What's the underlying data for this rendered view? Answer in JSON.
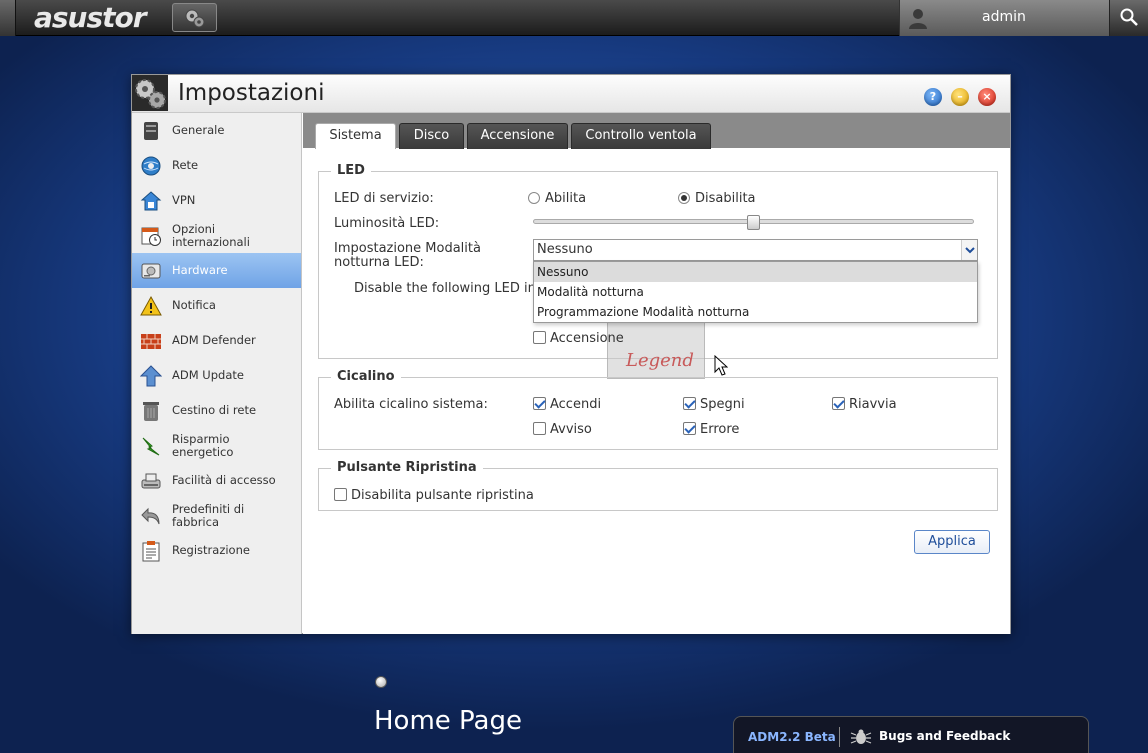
{
  "topbar": {
    "logo": "asustor",
    "user": "admin"
  },
  "window": {
    "title": "Impostazioni",
    "help_label": "?",
    "min_label": "–",
    "close_label": "×"
  },
  "sidebar": {
    "items": [
      {
        "label": "Generale",
        "icon": "server-icon"
      },
      {
        "label": "Rete",
        "icon": "globe-icon"
      },
      {
        "label": "VPN",
        "icon": "vpn-icon"
      },
      {
        "label": "Opzioni internazionali",
        "icon": "calendar-clock-icon"
      },
      {
        "label": "Hardware",
        "icon": "hard-drive-icon"
      },
      {
        "label": "Notifica",
        "icon": "warning-icon"
      },
      {
        "label": "ADM Defender",
        "icon": "firewall-icon"
      },
      {
        "label": "ADM Update",
        "icon": "update-arrow-icon"
      },
      {
        "label": "Cestino di rete",
        "icon": "trash-icon"
      },
      {
        "label": "Risparmio energetico",
        "icon": "lightning-icon"
      },
      {
        "label": "Facilità di accesso",
        "icon": "access-icon"
      },
      {
        "label": "Predefiniti di fabbrica",
        "icon": "undo-icon"
      },
      {
        "label": "Registrazione",
        "icon": "clipboard-icon"
      }
    ],
    "active": "Hardware"
  },
  "tabs": [
    "Sistema",
    "Disco",
    "Accensione",
    "Controllo ventola"
  ],
  "active_tab": "Sistema",
  "led": {
    "legend": "LED",
    "service_label": "LED di servizio:",
    "enable": "Abilita",
    "disable": "Disabilita",
    "service_value": "Disabilita",
    "brightness_label": "Luminosità LED:",
    "brightness_level": 0.5,
    "night_label_1": "Impostazione Modalità",
    "night_label_2": "notturna LED:",
    "night_selected": "Nessuno",
    "night_options": [
      "Nessuno",
      "Modalità notturna",
      "Programmazione Modalità notturna"
    ],
    "disable_following": "Disable the following LED inc",
    "power_label": "Accensione",
    "power_checked": false
  },
  "buzzer": {
    "legend": "Cicalino",
    "label": "Abilita cicalino sistema:",
    "options": [
      {
        "label": "Accendi",
        "checked": true
      },
      {
        "label": "Spegni",
        "checked": true
      },
      {
        "label": "Riavvia",
        "checked": true
      },
      {
        "label": "Avviso",
        "checked": false
      },
      {
        "label": "Errore",
        "checked": true
      }
    ]
  },
  "reset": {
    "legend": "Pulsante Ripristina",
    "label": "Disabilita pulsante ripristina",
    "checked": false
  },
  "apply_label": "Applica",
  "watermark": "Legend",
  "desktop": {
    "home_label": "Home Page",
    "version": "ADM2.2 Beta",
    "bugs": "Bugs and Feedback"
  }
}
